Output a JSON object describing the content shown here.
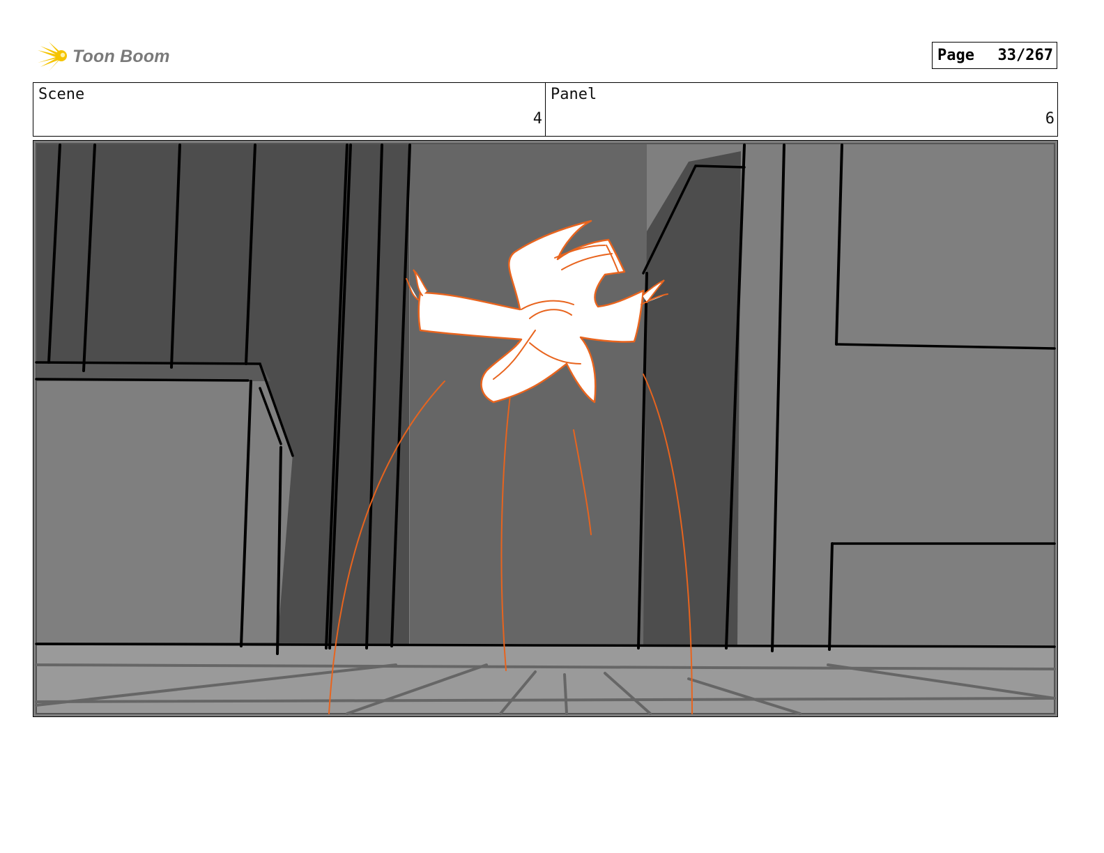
{
  "header": {
    "logo_text": "Toon Boom",
    "page_label": "Page",
    "page_value": "33/267"
  },
  "info": {
    "scene_label": "Scene",
    "scene_value": "4",
    "panel_label": "Panel",
    "panel_value": "6"
  },
  "colors": {
    "logo_yellow": "#f5c400",
    "logo_text": "#7a7a7a",
    "sketch_orange": "#e8641e",
    "wall_dark": "#4d4d4d",
    "wall_mid": "#666666",
    "wall_light": "#7f7f7f",
    "floor": "#9a9a9a"
  },
  "storyboard_panel": {
    "image": "sketch-panel-icon"
  }
}
